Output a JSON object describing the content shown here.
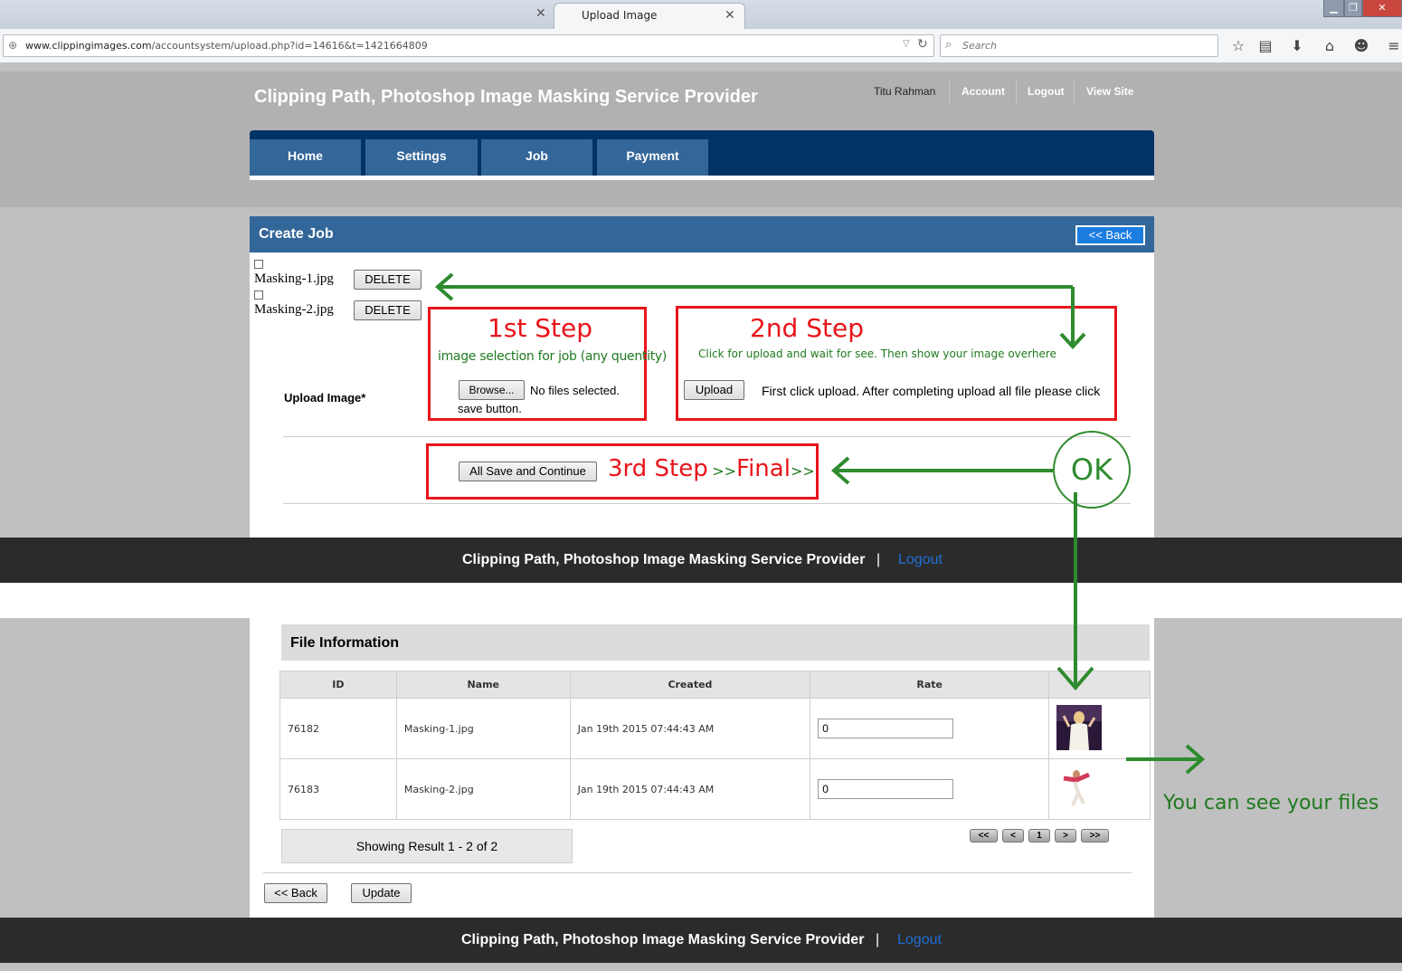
{
  "browser": {
    "tab_title": "Upload Image",
    "url_domain": "www.clippingimages.com",
    "url_path": "/accountsystem/upload.php?id=14616&t=1421664809",
    "search_placeholder": "Search"
  },
  "header": {
    "site_title": "Clipping Path, Photoshop Image Masking Service Provider",
    "user_name": "Titu Rahman",
    "account": "Account",
    "logout": "Logout",
    "view_site": "View Site"
  },
  "nav": {
    "home": "Home",
    "settings": "Settings",
    "job": "Job",
    "payment": "Payment"
  },
  "create_job": {
    "title": "Create Job",
    "back": "<< Back",
    "files": [
      {
        "name": "Masking-1.jpg",
        "delete": "DELETE"
      },
      {
        "name": "Masking-2.jpg",
        "delete": "DELETE"
      }
    ],
    "upload_label": "Upload Image*",
    "browse": "Browse...",
    "no_files": "No files selected.",
    "upload_btn": "Upload",
    "upload_hint": "First click upload. After completing upload all file please click",
    "upload_hint2": "save button.",
    "save_continue": "All Save and Continue"
  },
  "annotations": {
    "step1": "1st Step",
    "step1_sub": "image selection for job (any quentity)",
    "step2": "2nd Step",
    "step2_sub": "Click for upload and wait for see. Then show your image overhere",
    "step3": "3rd Step",
    "step3_arrows1": ">>",
    "step3_final": "Final",
    "step3_arrows2": ">>",
    "ok": "OK",
    "see_files": "You can see your files"
  },
  "footer": {
    "text": "Clipping Path, Photoshop Image Masking Service Provider",
    "sep": "|",
    "logout": "Logout"
  },
  "file_info": {
    "title": "File Information",
    "columns": [
      "ID",
      "Name",
      "Created",
      "Rate",
      ""
    ],
    "rows": [
      {
        "id": "76182",
        "name": "Masking-1.jpg",
        "created": "Jan 19th 2015 07:44:43 AM",
        "rate": "0"
      },
      {
        "id": "76183",
        "name": "Masking-2.jpg",
        "created": "Jan 19th 2015 07:44:43 AM",
        "rate": "0"
      }
    ],
    "showing": "Showing Result 1 - 2 of 2",
    "pager": {
      "first": "<<",
      "prev": "<",
      "page": "1",
      "next": ">",
      "last": ">>"
    },
    "back": "<< Back",
    "update": "Update"
  },
  "colors": {
    "nav_dark": "#003366",
    "nav_tab": "#336699",
    "annotation_red": "#e8141a",
    "annotation_green": "#1f7a1f"
  }
}
